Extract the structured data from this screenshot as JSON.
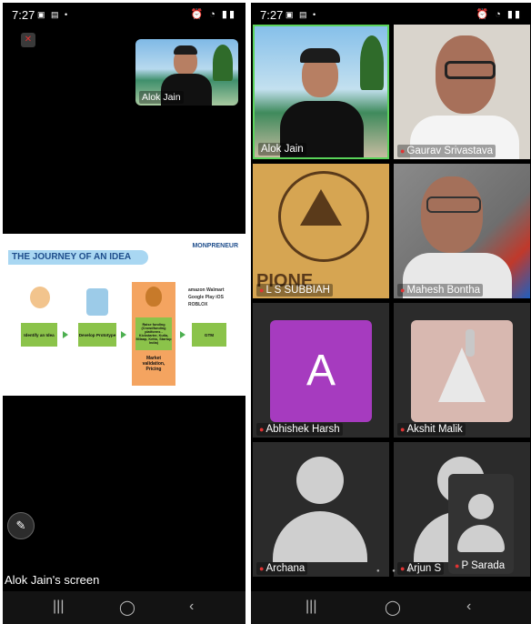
{
  "left_phone": {
    "status_time": "7:27",
    "self_view_name": "Alok Jain",
    "slide": {
      "brand": "MONPRENEUR",
      "title": "THE JOURNEY OF AN IDEA",
      "step1": "Identify an Idea",
      "step2": "Develop Prototype",
      "step3": "Raise funding (Crowdfunding platforms - Kickstarter, Kutla, Milaap, Ketto, Startup India)",
      "step3_note": "Market validation, Pricing",
      "step4": "GTM",
      "platforms": "amazon Walmart Google Play iOS ROBLOX"
    },
    "screen_label": "Alok Jain's screen"
  },
  "right_phone": {
    "status_time": "7:27",
    "participants": [
      {
        "name": "Alok Jain",
        "avatar_letter": ""
      },
      {
        "name": "Gaurav Srivastava",
        "avatar_letter": ""
      },
      {
        "name": "L S SUBBIAH",
        "avatar_letter": ""
      },
      {
        "name": "Mahesh Bontha",
        "avatar_letter": ""
      },
      {
        "name": "Abhishek Harsh",
        "avatar_letter": "A"
      },
      {
        "name": "Akshit Malik",
        "avatar_letter": ""
      },
      {
        "name": "Archana",
        "avatar_letter": ""
      },
      {
        "name": "Arjun S",
        "avatar_letter": ""
      }
    ],
    "floating_tile_name": "P Sarada"
  },
  "colors": {
    "speaking_border": "#5ad35a",
    "avatar_purple": "#a63bbf",
    "mic_muted": "#e13333"
  }
}
